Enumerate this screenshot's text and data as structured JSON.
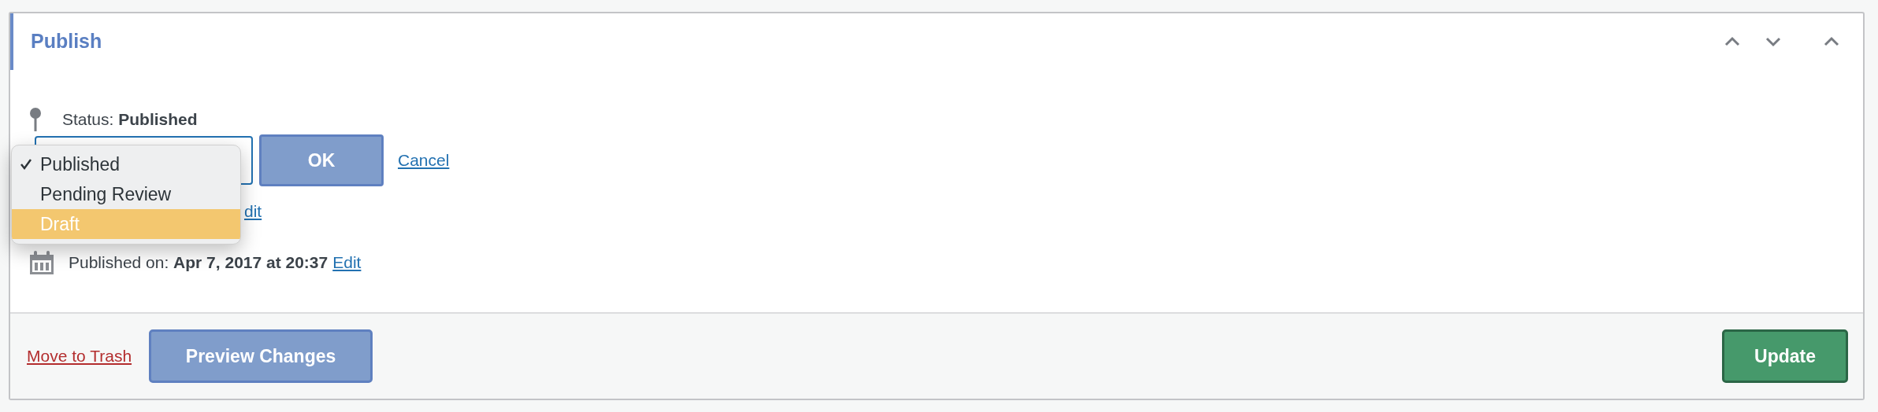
{
  "panel": {
    "title": "Publish",
    "controls": [
      {
        "kind": "up"
      },
      {
        "kind": "down"
      },
      {
        "kind": "up"
      }
    ]
  },
  "status": {
    "label": "Status:",
    "value": "Published",
    "ok_button": "OK",
    "cancel_link": "Cancel",
    "options": [
      {
        "label": "Published",
        "selected": true,
        "highlighted": false
      },
      {
        "label": "Pending Review",
        "selected": false,
        "highlighted": false
      },
      {
        "label": "Draft",
        "selected": false,
        "highlighted": true
      }
    ]
  },
  "visibility": {
    "edit_link": "dit"
  },
  "published_on": {
    "label": "Published on:",
    "value": "Apr 7, 2017 at 20:37",
    "edit_link": "Edit"
  },
  "footer": {
    "trash_link": "Move to Trash",
    "preview_button": "Preview Changes",
    "update_button": "Update"
  }
}
